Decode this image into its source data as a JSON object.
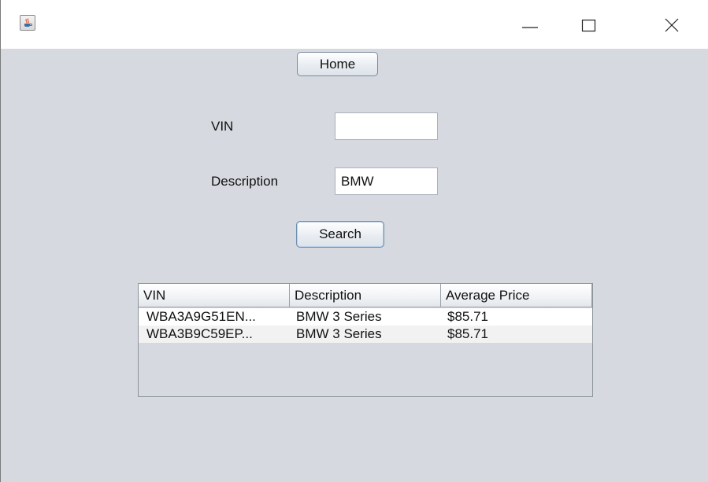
{
  "window": {
    "title": "",
    "controls": {
      "minimize_icon": "minimize-icon",
      "maximize_icon": "maximize-icon",
      "close_icon": "close-icon"
    },
    "app_icon": "java-cup-icon"
  },
  "nav": {
    "home_label": "Home"
  },
  "form": {
    "vin_label": "VIN",
    "vin_value": "",
    "description_label": "Description",
    "description_value": "BMW",
    "search_label": "Search"
  },
  "table": {
    "columns": [
      "VIN",
      "Description",
      "Average Price"
    ],
    "rows": [
      [
        "WBA3A9G51EN...",
        "BMW 3 Series",
        "$85.71"
      ],
      [
        "WBA3B9C59EP...",
        "BMW 3 Series",
        "$85.71"
      ]
    ]
  },
  "colors": {
    "panel_background": "#d6d9df",
    "titlebar_background": "#ffffff",
    "focus_border": "#6f8fb0"
  }
}
